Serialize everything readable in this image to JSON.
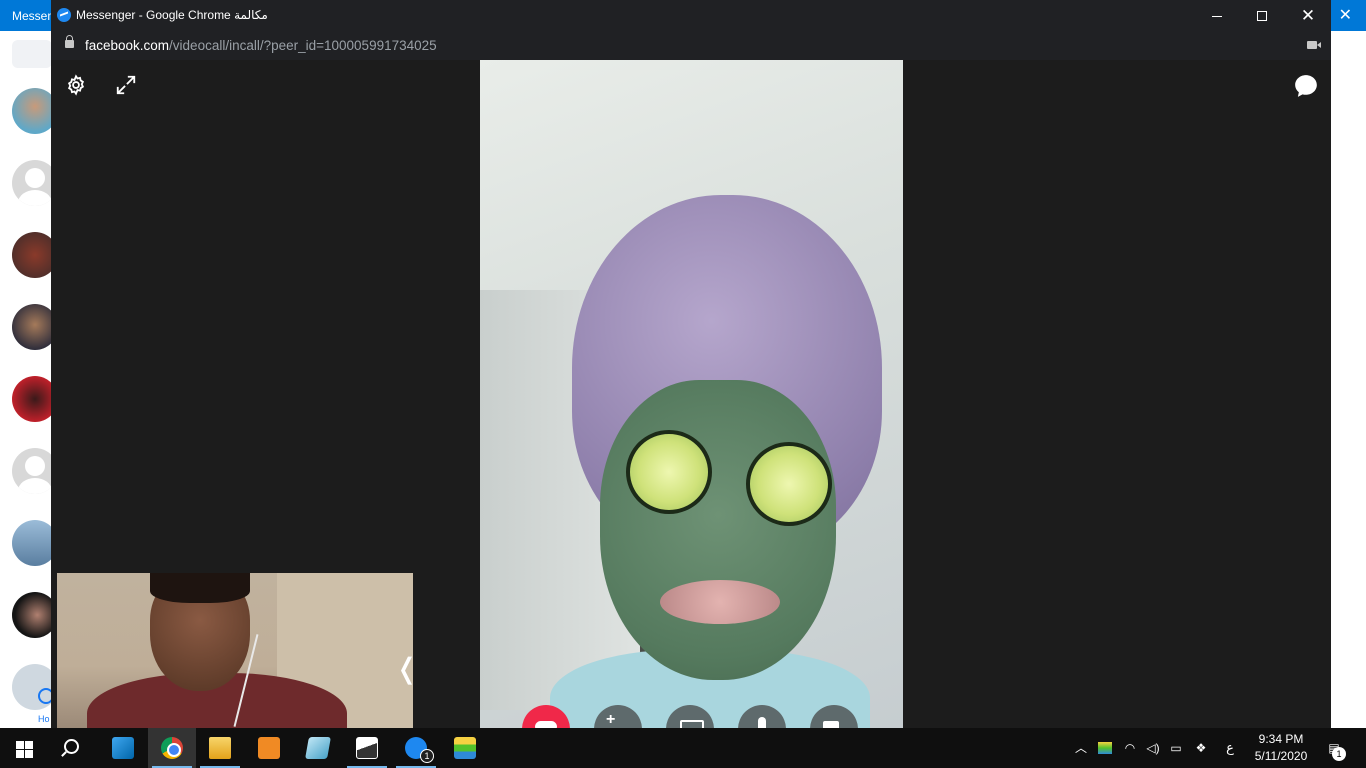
{
  "background_window": {
    "title": "Messen",
    "home_label": "Ho"
  },
  "window": {
    "title": "Messenger - Google Chrome مكالمة"
  },
  "address_bar": {
    "domain": "facebook.com",
    "path": "/videocall/incall/?peer_id=100005991734025"
  },
  "call": {
    "collapse_label": "❬"
  },
  "icons": {
    "settings": "gear-icon",
    "fullscreen": "expand-icon",
    "chat": "chat-bubble-icon",
    "end_call": "phone-hangup-icon",
    "add_person": "add-person-icon",
    "screen_share": "screen-share-icon",
    "mic": "microphone-icon",
    "video": "video-camera-icon"
  },
  "taskbar": {
    "messenger_badge": "1",
    "tray_lang": "ع",
    "time": "9:34 PM",
    "date": "5/11/2020",
    "notification_count": "1"
  },
  "colors": {
    "accent": "#0078d7",
    "end_call": "#f02849",
    "window_bg": "#1c1c1c"
  }
}
